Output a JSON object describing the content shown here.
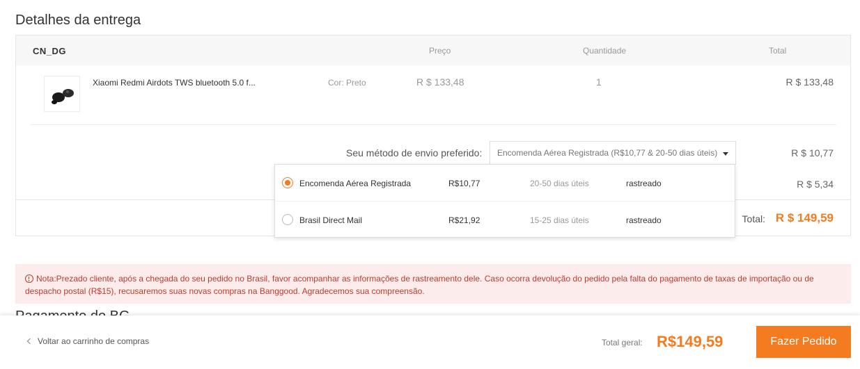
{
  "section_title": "Detalhes da entrega",
  "order": {
    "warehouse": "CN_DG",
    "columns": {
      "price": "Preço",
      "quantity": "Quantidade",
      "total": "Total"
    },
    "product": {
      "name": "Xiaomi Redmi Airdots TWS bluetooth 5.0 f...",
      "color": "Cor: Preto",
      "price": "R $ 133,48",
      "quantity": "1",
      "total": "R $ 133,48"
    },
    "shipping": {
      "label": "Seu método de envio preferido:",
      "selected": "Encomenda Aérea Registrada (R$10,77 & 20-50 dias úteis)",
      "cost": "R $ 10,77",
      "insurance_cost": "R $ 5,34",
      "options": [
        {
          "name": "Encomenda Aérea Registrada",
          "price": "R$10,77",
          "days": "20-50 dias úteis",
          "tracking": "rastreado",
          "selected": true
        },
        {
          "name": "Brasil Direct Mail",
          "price": "R$21,92",
          "days": "15-25 dias úteis",
          "tracking": "rastreado",
          "selected": false
        }
      ]
    },
    "total_label": "Total:",
    "total_value": "R $ 149,59"
  },
  "notice": {
    "text": "Nota:Prezado cliente, após a chegada do seu pedido no Brasil, favor acompanhar as informações de rastreamento dele. Caso ocorra devolução do pedido pela falta do pagamento de taxas de importação ou de despacho postal (R$15), recusaremos suas novas compras na Banggood. Agradecemos sua compreensão."
  },
  "next_section_title": "Pagamento do BG",
  "footer": {
    "back_label": "Voltar ao carrinho de compras",
    "grand_total_label": "Total geral:",
    "grand_total_value": "R$149,59",
    "place_order_label": "Fazer Pedido"
  },
  "colors": {
    "accent": "#f47b20",
    "notice_bg": "#fdecec",
    "notice_text": "#c0392b"
  }
}
